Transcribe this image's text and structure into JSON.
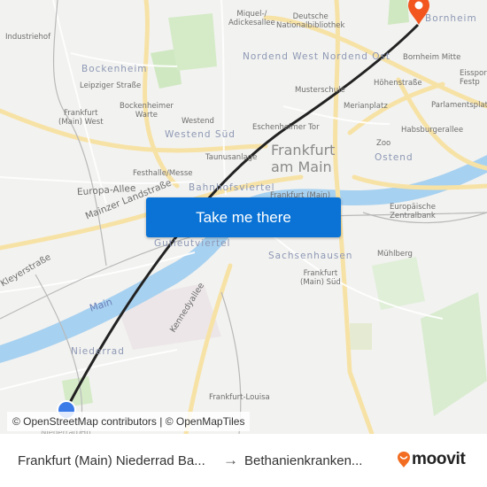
{
  "map": {
    "labels": {
      "industriehof": "Industriehof",
      "bockenheim": "Bockenheim",
      "leipziger": "Leipziger Straße",
      "bockenheimer_warte": "Bockenheimer\nWarte",
      "ffm_west": "Frankfurt\n(Main) West",
      "westend": "Westend",
      "westend_sued": "Westend Süd",
      "miquel": "Miquel-/\nAdickesallee",
      "dnb": "Deutsche\nNationalbibliothek",
      "nordend_west": "Nordend West",
      "nordend_ost": "Nordend Ost",
      "bornheim": "Bornheim",
      "bornheim_mitte": "Bornheim Mitte",
      "eissport": "Eissport\nFestp",
      "hoehenstrasse": "Höhenstraße",
      "musterschule": "Musterschule",
      "merianplatz": "Merianplatz",
      "parlamentsplatz": "Parlamentsplatz",
      "eschenheimer_tor": "Eschenheimer Tor",
      "habsburgerallee": "Habsburgerallee",
      "zoo": "Zoo",
      "frankfurt_am_main": "Frankfurt\nam Main",
      "ostend": "Ostend",
      "taunusanlage": "Taunusanlage",
      "festhalle": "Festhalle/Messe",
      "europa_allee": "Europa-Allee",
      "mainzer_landstrasse": "Mainzer Landstraße",
      "bahnhofsviertel": "Bahnhofsviertel",
      "ffm_hbf": "Frankfurt (Main)",
      "ezb": "Europäische\nZentralbank",
      "gutleutviertel": "Gutleutviertel",
      "sachsenhausen": "Sachsenhausen",
      "muehlberg": "Mühlberg",
      "ffm_sued": "Frankfurt\n(Main) Süd",
      "kleyerstrasse": "Kleyerstraße",
      "main_river": "Main",
      "niederrad": "Niederrad",
      "kennedyallee": "Kennedyallee",
      "louisa": "Frankfurt-Louisa",
      "niederrad_hbf": "Niederrad Hp"
    },
    "origin_marker_color": "#3b7be8",
    "destination_marker_color": "#f2551e",
    "route_color": "#222222"
  },
  "cta": {
    "label": "Take me there",
    "color": "#0a73d5"
  },
  "attribution": "© OpenStreetMap contributors | © OpenMapTiles",
  "footer": {
    "from": "Frankfurt (Main) Niederrad Ba...",
    "arrow": "→",
    "to": "Bethanienkranken...",
    "brand": "moovit",
    "brand_color": "#f26d21"
  }
}
